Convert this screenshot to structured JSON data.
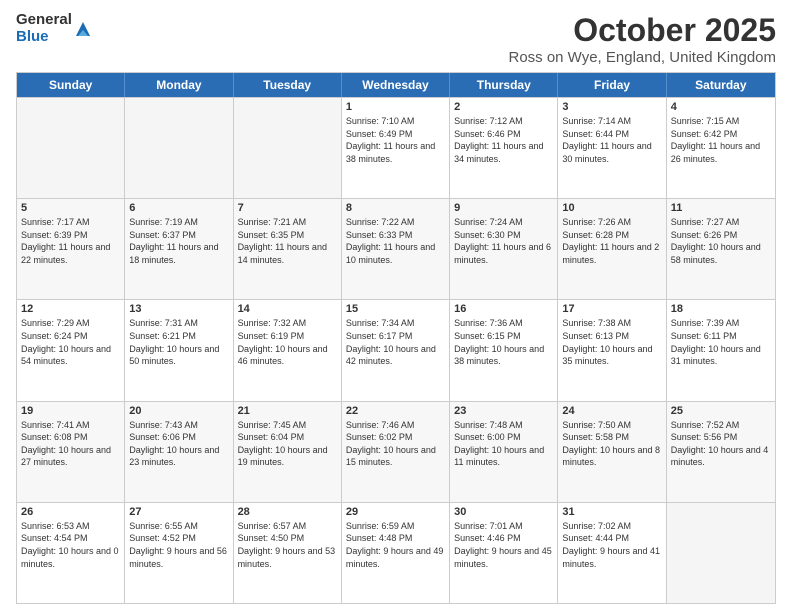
{
  "logo": {
    "general": "General",
    "blue": "Blue"
  },
  "title": "October 2025",
  "subtitle": "Ross on Wye, England, United Kingdom",
  "headers": [
    "Sunday",
    "Monday",
    "Tuesday",
    "Wednesday",
    "Thursday",
    "Friday",
    "Saturday"
  ],
  "rows": [
    [
      {
        "day": "",
        "sun": "",
        "set": "",
        "day_text": ""
      },
      {
        "day": "",
        "sun": "",
        "set": "",
        "day_text": ""
      },
      {
        "day": "",
        "sun": "",
        "set": "",
        "day_text": ""
      },
      {
        "day": "1",
        "sun": "Sunrise: 7:10 AM",
        "set": "Sunset: 6:49 PM",
        "day_text": "Daylight: 11 hours and 38 minutes."
      },
      {
        "day": "2",
        "sun": "Sunrise: 7:12 AM",
        "set": "Sunset: 6:46 PM",
        "day_text": "Daylight: 11 hours and 34 minutes."
      },
      {
        "day": "3",
        "sun": "Sunrise: 7:14 AM",
        "set": "Sunset: 6:44 PM",
        "day_text": "Daylight: 11 hours and 30 minutes."
      },
      {
        "day": "4",
        "sun": "Sunrise: 7:15 AM",
        "set": "Sunset: 6:42 PM",
        "day_text": "Daylight: 11 hours and 26 minutes."
      }
    ],
    [
      {
        "day": "5",
        "sun": "Sunrise: 7:17 AM",
        "set": "Sunset: 6:39 PM",
        "day_text": "Daylight: 11 hours and 22 minutes."
      },
      {
        "day": "6",
        "sun": "Sunrise: 7:19 AM",
        "set": "Sunset: 6:37 PM",
        "day_text": "Daylight: 11 hours and 18 minutes."
      },
      {
        "day": "7",
        "sun": "Sunrise: 7:21 AM",
        "set": "Sunset: 6:35 PM",
        "day_text": "Daylight: 11 hours and 14 minutes."
      },
      {
        "day": "8",
        "sun": "Sunrise: 7:22 AM",
        "set": "Sunset: 6:33 PM",
        "day_text": "Daylight: 11 hours and 10 minutes."
      },
      {
        "day": "9",
        "sun": "Sunrise: 7:24 AM",
        "set": "Sunset: 6:30 PM",
        "day_text": "Daylight: 11 hours and 6 minutes."
      },
      {
        "day": "10",
        "sun": "Sunrise: 7:26 AM",
        "set": "Sunset: 6:28 PM",
        "day_text": "Daylight: 11 hours and 2 minutes."
      },
      {
        "day": "11",
        "sun": "Sunrise: 7:27 AM",
        "set": "Sunset: 6:26 PM",
        "day_text": "Daylight: 10 hours and 58 minutes."
      }
    ],
    [
      {
        "day": "12",
        "sun": "Sunrise: 7:29 AM",
        "set": "Sunset: 6:24 PM",
        "day_text": "Daylight: 10 hours and 54 minutes."
      },
      {
        "day": "13",
        "sun": "Sunrise: 7:31 AM",
        "set": "Sunset: 6:21 PM",
        "day_text": "Daylight: 10 hours and 50 minutes."
      },
      {
        "day": "14",
        "sun": "Sunrise: 7:32 AM",
        "set": "Sunset: 6:19 PM",
        "day_text": "Daylight: 10 hours and 46 minutes."
      },
      {
        "day": "15",
        "sun": "Sunrise: 7:34 AM",
        "set": "Sunset: 6:17 PM",
        "day_text": "Daylight: 10 hours and 42 minutes."
      },
      {
        "day": "16",
        "sun": "Sunrise: 7:36 AM",
        "set": "Sunset: 6:15 PM",
        "day_text": "Daylight: 10 hours and 38 minutes."
      },
      {
        "day": "17",
        "sun": "Sunrise: 7:38 AM",
        "set": "Sunset: 6:13 PM",
        "day_text": "Daylight: 10 hours and 35 minutes."
      },
      {
        "day": "18",
        "sun": "Sunrise: 7:39 AM",
        "set": "Sunset: 6:11 PM",
        "day_text": "Daylight: 10 hours and 31 minutes."
      }
    ],
    [
      {
        "day": "19",
        "sun": "Sunrise: 7:41 AM",
        "set": "Sunset: 6:08 PM",
        "day_text": "Daylight: 10 hours and 27 minutes."
      },
      {
        "day": "20",
        "sun": "Sunrise: 7:43 AM",
        "set": "Sunset: 6:06 PM",
        "day_text": "Daylight: 10 hours and 23 minutes."
      },
      {
        "day": "21",
        "sun": "Sunrise: 7:45 AM",
        "set": "Sunset: 6:04 PM",
        "day_text": "Daylight: 10 hours and 19 minutes."
      },
      {
        "day": "22",
        "sun": "Sunrise: 7:46 AM",
        "set": "Sunset: 6:02 PM",
        "day_text": "Daylight: 10 hours and 15 minutes."
      },
      {
        "day": "23",
        "sun": "Sunrise: 7:48 AM",
        "set": "Sunset: 6:00 PM",
        "day_text": "Daylight: 10 hours and 11 minutes."
      },
      {
        "day": "24",
        "sun": "Sunrise: 7:50 AM",
        "set": "Sunset: 5:58 PM",
        "day_text": "Daylight: 10 hours and 8 minutes."
      },
      {
        "day": "25",
        "sun": "Sunrise: 7:52 AM",
        "set": "Sunset: 5:56 PM",
        "day_text": "Daylight: 10 hours and 4 minutes."
      }
    ],
    [
      {
        "day": "26",
        "sun": "Sunrise: 6:53 AM",
        "set": "Sunset: 4:54 PM",
        "day_text": "Daylight: 10 hours and 0 minutes."
      },
      {
        "day": "27",
        "sun": "Sunrise: 6:55 AM",
        "set": "Sunset: 4:52 PM",
        "day_text": "Daylight: 9 hours and 56 minutes."
      },
      {
        "day": "28",
        "sun": "Sunrise: 6:57 AM",
        "set": "Sunset: 4:50 PM",
        "day_text": "Daylight: 9 hours and 53 minutes."
      },
      {
        "day": "29",
        "sun": "Sunrise: 6:59 AM",
        "set": "Sunset: 4:48 PM",
        "day_text": "Daylight: 9 hours and 49 minutes."
      },
      {
        "day": "30",
        "sun": "Sunrise: 7:01 AM",
        "set": "Sunset: 4:46 PM",
        "day_text": "Daylight: 9 hours and 45 minutes."
      },
      {
        "day": "31",
        "sun": "Sunrise: 7:02 AM",
        "set": "Sunset: 4:44 PM",
        "day_text": "Daylight: 9 hours and 41 minutes."
      },
      {
        "day": "",
        "sun": "",
        "set": "",
        "day_text": ""
      }
    ]
  ]
}
